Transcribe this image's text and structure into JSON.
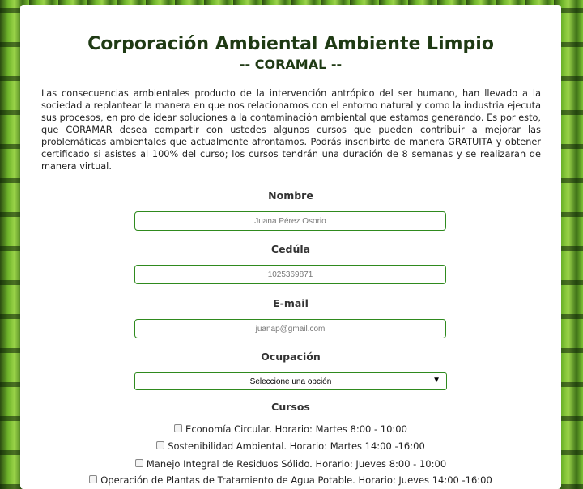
{
  "header": {
    "title": "Corporación Ambiental Ambiente Limpio",
    "subtitle": "-- CORAMAL --"
  },
  "intro": "Las consecuencias ambientales producto de la intervención antrópico del ser humano, han llevado a la sociedad a replantear la manera en que nos relacionamos con el entorno natural y como la industria ejecuta sus procesos, en pro de idear soluciones a la contaminación ambiental que estamos generando. Es por esto, que CORAMAR desea compartir con ustedes algunos cursos que pueden contribuir a mejorar las problemáticas ambientales que actualmente afrontamos. Podrás inscribirte de manera GRATUITA y obtener certificado si asistes al 100% del curso; los cursos tendrán una duración de 8 semanas y se realizaran de manera virtual.",
  "form": {
    "nombre": {
      "label": "Nombre",
      "placeholder": "Juana Pérez Osorio"
    },
    "cedula": {
      "label": "Cedúla",
      "placeholder": "1025369871"
    },
    "email": {
      "label": "E-mail",
      "placeholder": "juanap@gmail.com"
    },
    "ocupacion": {
      "label": "Ocupación",
      "selected": "Seleccione una opción"
    },
    "cursos": {
      "label": "Cursos",
      "items": [
        {
          "label": "Economía Circular. Horario: Martes 8:00 - 10:00",
          "checked": false
        },
        {
          "label": "Sostenibilidad Ambiental. Horario: Martes 14:00 -16:00",
          "checked": false
        },
        {
          "label": "Manejo Integral de Residuos Sólido. Horario: Jueves 8:00 - 10:00",
          "checked": false
        },
        {
          "label": "Operación de Plantas de Tratamiento de Agua Potable. Horario: Jueves 14:00 -16:00",
          "checked": false
        }
      ]
    }
  },
  "colors": {
    "accent": "#2f8a1e",
    "title": "#1f3a14"
  },
  "icons": {
    "select_arrow": "triangle-down-icon",
    "checkbox": "checkbox-icon"
  }
}
